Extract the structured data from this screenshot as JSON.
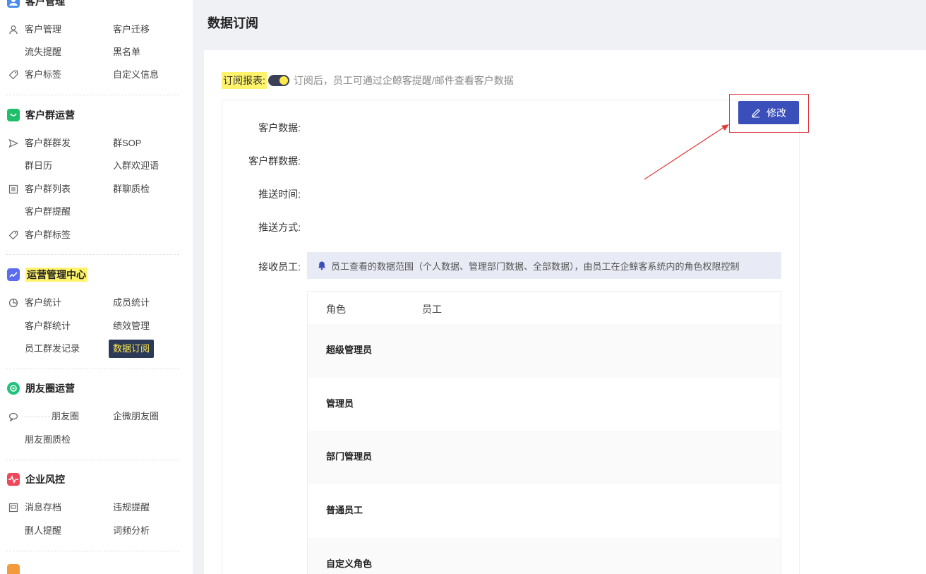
{
  "sidebar": {
    "sections": [
      {
        "title": "客户管理",
        "icon": "customer-icon"
      },
      {
        "title": "客户群运营",
        "icon": "chat-bubble-icon"
      },
      {
        "title": "运营管理中心",
        "icon": "trend-chart-icon"
      },
      {
        "title": "朋友圈运营",
        "icon": "aperture-icon"
      },
      {
        "title": "企业风控",
        "icon": "pulse-icon"
      }
    ],
    "items": {
      "customer_manage": "客户管理",
      "customer_migrate": "客户迁移",
      "churn_reminder": "流失提醒",
      "blacklist": "黑名单",
      "customer_tags": "客户标签",
      "custom_info": "自定义信息",
      "group_broadcast": "客户群群发",
      "group_sop": "群SOP",
      "group_calendar": "群日历",
      "group_welcome": "入群欢迎语",
      "group_list": "客户群列表",
      "group_chat_qc": "群聊质检",
      "group_reminder": "客户群提醒",
      "group_tags": "客户群标签",
      "customer_stats": "客户统计",
      "member_stats": "成员统计",
      "group_stats": "客户群统计",
      "performance": "绩效管理",
      "staff_broadcast_log": "员工群发记录",
      "data_subscription": "数据订阅",
      "moments": "朋友圈",
      "wecom_moments": "企微朋友圈",
      "moments_qc": "朋友圈质检",
      "message_archive": "消息存档",
      "violation_reminder": "违规提醒",
      "delete_reminder": "删人提醒",
      "word_frequency": "词频分析"
    }
  },
  "page": {
    "title": "数据订阅",
    "subscribe_label": "订阅报表:",
    "subscribe_enabled": true,
    "subscribe_hint": "订阅后，员工可通过企鲸客提醒/邮件查看客户数据",
    "edit_button": "修改",
    "fields": {
      "customer_data": "客户数据:",
      "group_data": "客户群数据:",
      "push_time": "推送时间:",
      "push_method": "推送方式:",
      "receivers": "接收员工:"
    },
    "notice": "员工查看的数据范围（个人数据、管理部门数据、全部数据），由员工在企鲸客系统内的角色权限控制",
    "table": {
      "headers": [
        "角色",
        "员工"
      ],
      "rows": [
        "超级管理员",
        "管理员",
        "部门管理员",
        "普通员工",
        "自定义角色"
      ]
    }
  },
  "colors": {
    "highlight": "#fff36b",
    "primary_button": "#3b4fbb",
    "annotation_red": "#d9363e",
    "active_nav_bg": "#2d3a57"
  }
}
